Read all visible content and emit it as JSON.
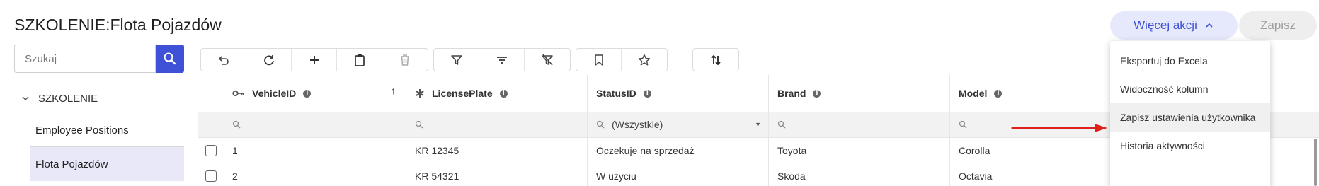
{
  "page": {
    "title": "SZKOLENIE:Flota Pojazdów"
  },
  "header": {
    "more_actions_label": "Więcej akcji",
    "save_label": "Zapisz"
  },
  "search": {
    "placeholder": "Szukaj"
  },
  "tree": {
    "root_label": "SZKOLENIE",
    "items": [
      {
        "label": "Employee Positions"
      },
      {
        "label": "Flota Pojazdów",
        "selected": true
      }
    ]
  },
  "toolbar": {
    "groups": [
      [
        "undo-icon",
        "refresh-icon",
        "plus-icon",
        "clipboard-icon",
        "trash-icon"
      ],
      [
        "filter-icon",
        "filter-lines-icon",
        "clear-filter-icon"
      ],
      [
        "bookmark-icon",
        "star-icon"
      ],
      [
        "sort-arrows-icon"
      ]
    ]
  },
  "grid": {
    "columns": [
      {
        "label": "VehicleID",
        "icon": "key-icon",
        "sorted": "asc"
      },
      {
        "label": "LicensePlate",
        "icon": "asterisk-icon"
      },
      {
        "label": "StatusID"
      },
      {
        "label": "Brand"
      },
      {
        "label": "Model"
      }
    ],
    "filters": {
      "status": "(Wszystkie)"
    },
    "rows": [
      {
        "id": "1",
        "plate": "KR 12345",
        "status": "Oczekuje na sprzedaż",
        "brand": "Toyota",
        "model": "Corolla"
      },
      {
        "id": "2",
        "plate": "KR 54321",
        "status": "W użyciu",
        "brand": "Skoda",
        "model": "Octavia"
      }
    ]
  },
  "menu": {
    "items": [
      {
        "label": "Eksportuj do Excela"
      },
      {
        "label": "Widoczność kolumn"
      },
      {
        "label": "Zapisz ustawienia użytkownika",
        "highlighted": true
      },
      {
        "label": "Historia aktywności"
      }
    ]
  },
  "colors": {
    "accent": "#3f51d6",
    "selected_bg": "#e8e8f8",
    "annotation": "#e0201a"
  }
}
